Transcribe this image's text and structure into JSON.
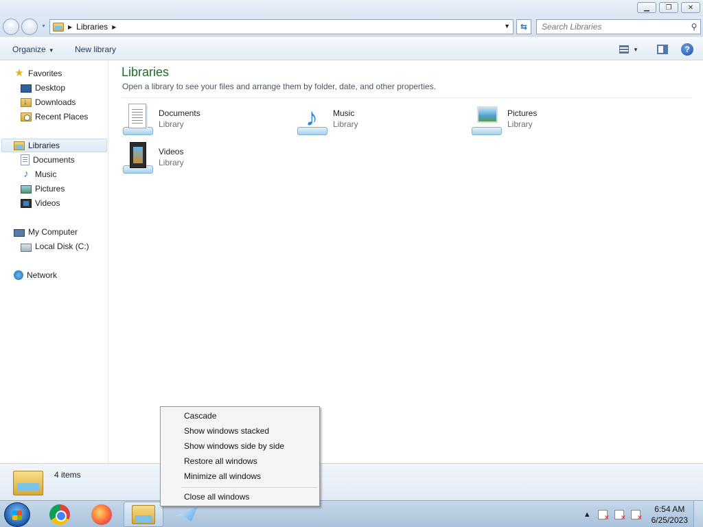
{
  "address": {
    "segment": "Libraries",
    "search_placeholder": "Search Libraries"
  },
  "toolbar": {
    "organize": "Organize",
    "new_library": "New library"
  },
  "sidebar": {
    "favorites": "Favorites",
    "favorites_items": [
      "Desktop",
      "Downloads",
      "Recent Places"
    ],
    "libraries": "Libraries",
    "libraries_items": [
      "Documents",
      "Music",
      "Pictures",
      "Videos"
    ],
    "computer": "My Computer",
    "computer_items": [
      "Local Disk (C:)"
    ],
    "network": "Network"
  },
  "main": {
    "title": "Libraries",
    "subtitle": "Open a library to see your files and arrange them by folder, date, and other properties.",
    "libraries": [
      {
        "name": "Documents",
        "type": "Library"
      },
      {
        "name": "Music",
        "type": "Library"
      },
      {
        "name": "Pictures",
        "type": "Library"
      },
      {
        "name": "Videos",
        "type": "Library"
      }
    ]
  },
  "details": {
    "count": "4 items"
  },
  "context_menu": {
    "items": [
      "Cascade",
      "Show windows stacked",
      "Show windows side by side",
      "Restore all windows",
      "Minimize all windows"
    ],
    "close_all": "Close all windows"
  },
  "taskbar": {
    "time": "6:54 AM",
    "date": "6/25/2023"
  }
}
